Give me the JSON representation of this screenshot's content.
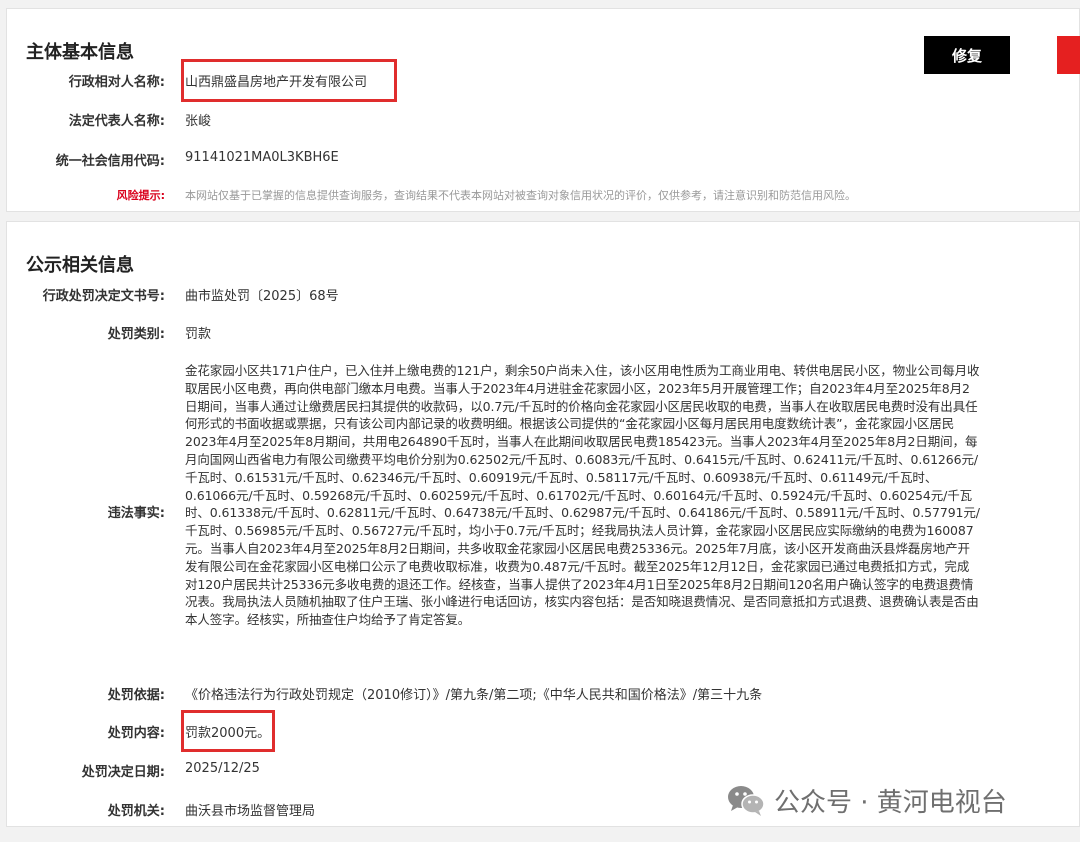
{
  "basic": {
    "title": "主体基本信息",
    "subject_label": "行政相对人名称:",
    "subject_value": "山西鼎盛昌房地产开发有限公司",
    "rep_label": "法定代表人名称:",
    "rep_value": "张峻",
    "credit_label": "统一社会信用代码:",
    "credit_value": "91141021MA0L3KBH6E",
    "risk_label": "风险提示:",
    "risk_value": "本网站仅基于已掌握的信息提供查询服务，查询结果不代表本网站对被查询对象信用状况的评价，仅供参考，请注意识别和防范信用风险。",
    "repair_button": "修复"
  },
  "publicity": {
    "title": "公示相关信息",
    "doc_label": "行政处罚决定文书号:",
    "doc_value": "曲市监处罚〔2025〕68号",
    "type_label": "处罚类别:",
    "type_value": "罚款",
    "facts_label": "违法事实:",
    "facts_value": "金花家园小区共171户住户，已入住并上缴电费的121户，剩余50户尚未入住，该小区用电性质为工商业用电、转供电居民小区，物业公司每月收取居民小区电费，再向供电部门缴本月电费。当事人于2023年4月进驻金花家园小区，2023年5月开展管理工作；自2023年4月至2025年8月2日期间，当事人通过让缴费居民扫其提供的收款码，以0.7元/千瓦时的价格向金花家园小区居民收取的电费，当事人在收取居民电费时没有出具任何形式的书面收据或票据，只有该公司内部记录的收费明细。根据该公司提供的“金花家园小区每月居民用电度数统计表”，金花家园小区居民2023年4月至2025年8月期间，共用电264890千瓦时，当事人在此期间收取居民电费185423元。当事人2023年4月至2025年8月2日期间，每月向国网山西省电力有限公司缴费平均电价分别为0.62502元/千瓦时、0.6083元/千瓦时、0.6415元/千瓦时、0.62411元/千瓦时、0.61266元/千瓦时、0.61531元/千瓦时、0.62346元/千瓦时、0.60919元/千瓦时、0.58117元/千瓦时、0.60938元/千瓦时、0.61149元/千瓦时、0.61066元/千瓦时、0.59268元/千瓦时、0.60259元/千瓦时、0.61702元/千瓦时、0.60164元/千瓦时、0.5924元/千瓦时、0.60254元/千瓦时、0.61338元/千瓦时、0.62811元/千瓦时、0.64738元/千瓦时、0.62987元/千瓦时、0.64186元/千瓦时、0.58911元/千瓦时、0.57791元/千瓦时、0.56985元/千瓦时、0.56727元/千瓦时，均小于0.7元/千瓦时；经我局执法人员计算，金花家园小区居民应实际缴纳的电费为160087元。当事人自2023年4月至2025年8月2日期间，共多收取金花家园小区居民电费25336元。2025年7月底，该小区开发商曲沃县烨磊房地产开发有限公司在金花家园小区电梯口公示了电费收取标准，收费为0.487元/千瓦时。截至2025年12月12日，金花家园已通过电费抵扣方式，完成对120户居民共计25336元多收电费的退还工作。经核查，当事人提供了2023年4月1日至2025年8月2日期间120名用户确认签字的电费退费情况表。我局执法人员随机抽取了住户王瑞、张小峰进行电话回访，核实内容包括：是否知晓退费情况、是否同意抵扣方式退费、退费确认表是否由本人签字。经核实，所抽查住户均给予了肯定答复。",
    "basis_label": "处罚依据:",
    "basis_value": "《价格违法行为行政处罚规定（2010修订）》/第九条/第二项;《中华人民共和国价格法》/第三十九条",
    "content_label": "处罚内容:",
    "content_value": "罚款2000元。",
    "date_label": "处罚决定日期:",
    "date_value": "2025/12/25",
    "authority_label": "处罚机关:",
    "authority_value": "曲沃县市场监督管理局"
  },
  "watermark": {
    "text": "公众号 · 黄河电视台",
    "icon": "wechat-icon"
  },
  "colors": {
    "highlight": "#e02d2d",
    "risk": "#d9001b",
    "repair_button": "#000000",
    "side_button": "#e52020"
  }
}
